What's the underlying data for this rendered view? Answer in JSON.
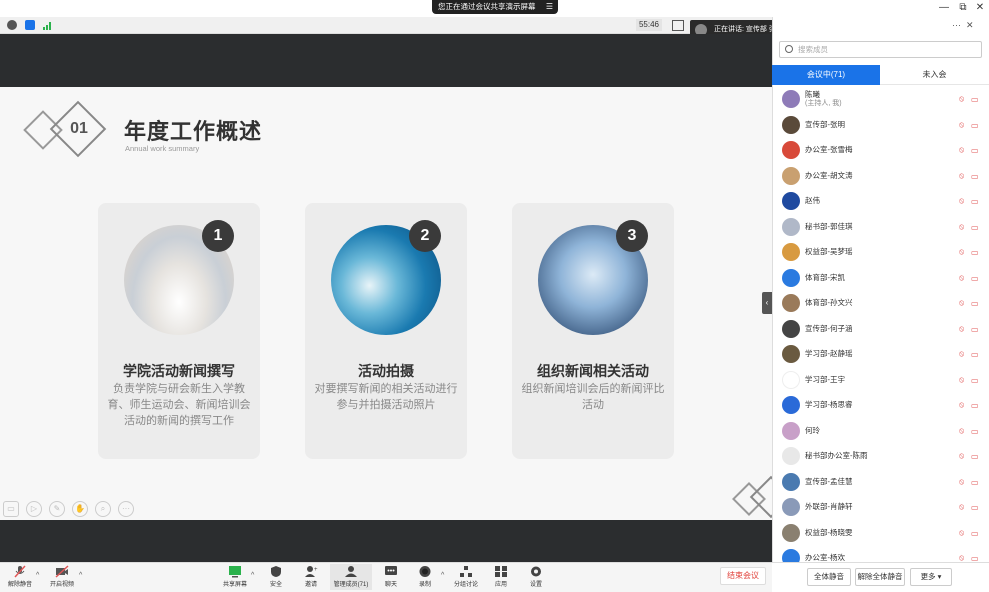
{
  "window": {
    "share_notice": "您正在通过会议共享演示屏幕",
    "min": "—",
    "restore": "⧉",
    "close": "✕"
  },
  "infobar": {
    "timer": "55:46",
    "speaking_label": "正在讲话: 宣传部 张明"
  },
  "slide": {
    "number_mark": "01",
    "title": "年度工作概述",
    "subtitle": "Annual work summary",
    "cards": [
      {
        "num": "1",
        "title": "学院活动新闻撰写",
        "desc": "负责学院与研会新生入学教育、师生运动会、新闻培训会活动的新闻的撰写工作"
      },
      {
        "num": "2",
        "title": "活动拍摄",
        "desc": "对要撰写新闻的相关活动进行参与并拍摄活动照片"
      },
      {
        "num": "3",
        "title": "组织新闻相关活动",
        "desc": "组织新闻培训会后的新闻评比活动"
      }
    ]
  },
  "toolbar": {
    "items": [
      {
        "label": "解除静音",
        "icon": "mic-muted-icon"
      },
      {
        "label": "开启视频",
        "icon": "video-off-icon"
      },
      {
        "label": "共享屏幕",
        "icon": "share-screen-icon"
      },
      {
        "label": "安全",
        "icon": "shield-icon"
      },
      {
        "label": "邀请",
        "icon": "invite-icon"
      },
      {
        "label": "管理成员(71)",
        "icon": "members-icon"
      },
      {
        "label": "聊天",
        "icon": "chat-icon"
      },
      {
        "label": "录制",
        "icon": "record-icon"
      },
      {
        "label": "分组讨论",
        "icon": "breakout-icon"
      },
      {
        "label": "应用",
        "icon": "apps-icon"
      },
      {
        "label": "设置",
        "icon": "settings-icon"
      }
    ],
    "end_label": "结束会议"
  },
  "panel": {
    "more": "···",
    "close": "✕",
    "search_placeholder": "搜索成员",
    "tab_in_meeting": "会议中(71)",
    "tab_waiting": "未入会",
    "members": [
      {
        "name": "陈曦",
        "role": "(主持人, 我)",
        "color": "#8e7bb8"
      },
      {
        "name": "宣传部-张明",
        "role": "",
        "color": "#5a4a3a"
      },
      {
        "name": "办公室-张雪梅",
        "role": "",
        "color": "#d84a3a"
      },
      {
        "name": "办公室-胡文涛",
        "role": "",
        "color": "#c9a070"
      },
      {
        "name": "赵伟",
        "role": "",
        "color": "#1f4aa0"
      },
      {
        "name": "秘书部-郭佳琪",
        "role": "",
        "color": "#b0b8c8"
      },
      {
        "name": "权益部-吴梦瑶",
        "role": "",
        "color": "#d89a40"
      },
      {
        "name": "体育部-宋凯",
        "role": "",
        "color": "#2a7ae0"
      },
      {
        "name": "体育部-孙文兴",
        "role": "",
        "color": "#9a7a5a"
      },
      {
        "name": "宣传部-何子涵",
        "role": "",
        "color": "#444"
      },
      {
        "name": "学习部-赵静瑶",
        "role": "",
        "color": "#6a5a40"
      },
      {
        "name": "学习部-王宇",
        "role": "",
        "color": "#ffffff"
      },
      {
        "name": "学习部-杨思睿",
        "role": "",
        "color": "#2a6ad8"
      },
      {
        "name": "何玲",
        "role": "",
        "color": "#c8a0c8"
      },
      {
        "name": "秘书部办公室-陈雨",
        "role": "",
        "color": "#e8e8e8"
      },
      {
        "name": "宣传部-孟佳慧",
        "role": "",
        "color": "#4a7ab0"
      },
      {
        "name": "外联部-肖静轩",
        "role": "",
        "color": "#8a9ab8"
      },
      {
        "name": "权益部-杨晓雯",
        "role": "",
        "color": "#8a8070"
      },
      {
        "name": "办公室-杨欢",
        "role": "",
        "color": "#2a7ae0"
      }
    ],
    "btn_mute_all": "全体静音",
    "btn_unmute_all": "解除全体静音",
    "btn_more": "更多 ▾"
  },
  "colors": {
    "accent": "#1a73e8",
    "end_red": "#e0413a",
    "muted_red": "#e05656"
  }
}
